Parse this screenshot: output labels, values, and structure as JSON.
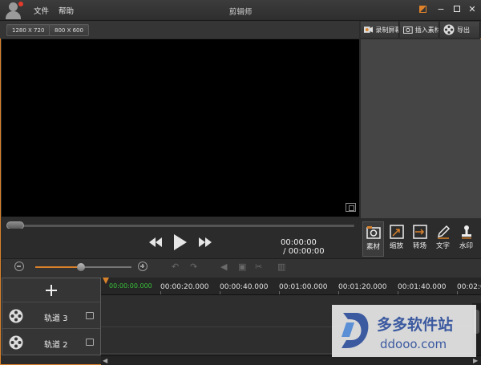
{
  "window": {
    "title": "剪辑师",
    "menu": [
      "文件",
      "帮助"
    ],
    "controls": [
      "skin-icon",
      "minimize-icon",
      "maximize-icon",
      "close-icon"
    ]
  },
  "resolution_buttons": [
    "1280 X 720",
    "800 X 600"
  ],
  "top_actions": [
    {
      "label": "录制屏幕",
      "icon": "record-icon"
    },
    {
      "label": "插入素材",
      "icon": "camera-icon"
    },
    {
      "label": "导出",
      "icon": "film-reel-icon"
    }
  ],
  "player": {
    "current_time": "00:00:00",
    "total_time": "00:00:00",
    "separator": " / ",
    "seek_progress": 0
  },
  "side_tabs": [
    {
      "label": "素材",
      "icon": "material-icon",
      "active": true
    },
    {
      "label": "缩放",
      "icon": "zoom-icon",
      "active": false
    },
    {
      "label": "转场",
      "icon": "transition-icon",
      "active": false
    },
    {
      "label": "文字",
      "icon": "pen-icon",
      "active": false
    },
    {
      "label": "水印",
      "icon": "stamp-icon",
      "active": false
    }
  ],
  "timeline": {
    "zoom_level": 0.48,
    "playhead_time": "00:00:00.000",
    "ruler_labels": [
      "00:00:20.000",
      "00:00:40.000",
      "00:01:00.000",
      "00:01:20.000",
      "00:01:40.000",
      "00:02:0"
    ],
    "tracks": [
      {
        "name": "轨道 3"
      },
      {
        "name": "轨道 2"
      }
    ]
  },
  "watermark": {
    "cn": "多多软件站",
    "en": "ddooo.com"
  },
  "colors": {
    "accent": "#d9822b",
    "playhead_time": "#39c23a",
    "watermark": "#3c5aa0"
  }
}
